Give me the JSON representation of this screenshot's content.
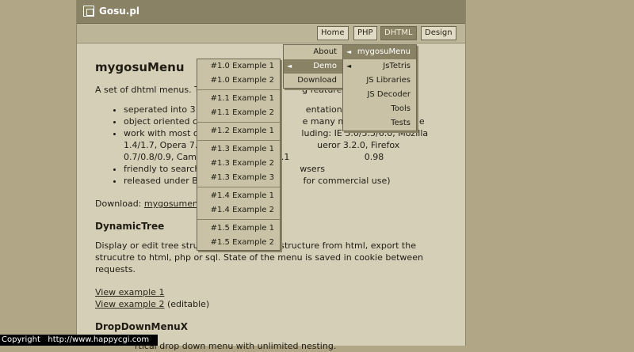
{
  "site": {
    "title": "Gosu.pl"
  },
  "nav": {
    "home": "Home",
    "php": "PHP",
    "dhtml": "DHTML",
    "design": "Design"
  },
  "content": {
    "heading": "mygosuMenu",
    "intro": "A set of dhtml menus. Th                                   g features:",
    "features": [
      "seperated into 3 la                                    entation, behav",
      "object oriented co                                    e many menus on one page",
      "work with most of                                    luding: IE 5.0/5.5/6.0, Mozilla 1.4/1.7, Opera 7.11/7.23/7                            ueror 3.2.0, Firefox 0.7/0.8/0.9, Camino 0.7, Netscape 7.1                           0.98",
      "friendly to search                                    wsers",
      "released under BS                                    for commercial use)"
    ],
    "download_label": "Download:",
    "download_link": "mygosumenu-",
    "dynamic_tree_title": "DynamicTree",
    "dynamic_tree_desc": "Display or edit tree structures. Import the structure from html, export the strucutre to html, php or sql. State of the menu is saved in cookie between requests.",
    "view_example_1": "View example 1",
    "view_example_2": "View example 2",
    "editable": "(editable)",
    "dropdown_title": "DropDownMenuX",
    "dropdown_desc": "rtical drop down menu with unlimited nesting."
  },
  "dhtml_menu": {
    "about": "About",
    "demo": "Demo",
    "download": "Download"
  },
  "sub_menu": [
    "mygosuMenu",
    "JsTetris",
    "JS Libraries",
    "JS Decoder",
    "Tools",
    "Tests"
  ],
  "examples_menu": {
    "g1": [
      "#1.0 Example 1",
      "#1.0 Example 2"
    ],
    "g2": [
      "#1.1 Example 1",
      "#1.1 Example 2"
    ],
    "g3": [
      "#1.2 Example 1"
    ],
    "g4": [
      "#1.3 Example 1",
      "#1.3 Example 2",
      "#1.3 Example 3"
    ],
    "g5": [
      "#1.4 Example 1",
      "#1.4 Example 2"
    ],
    "g6": [
      "#1.5 Example 1",
      "#1.5 Example 2"
    ]
  },
  "footer": {
    "copyright": "Copyright   http://www.happycgi.com"
  }
}
